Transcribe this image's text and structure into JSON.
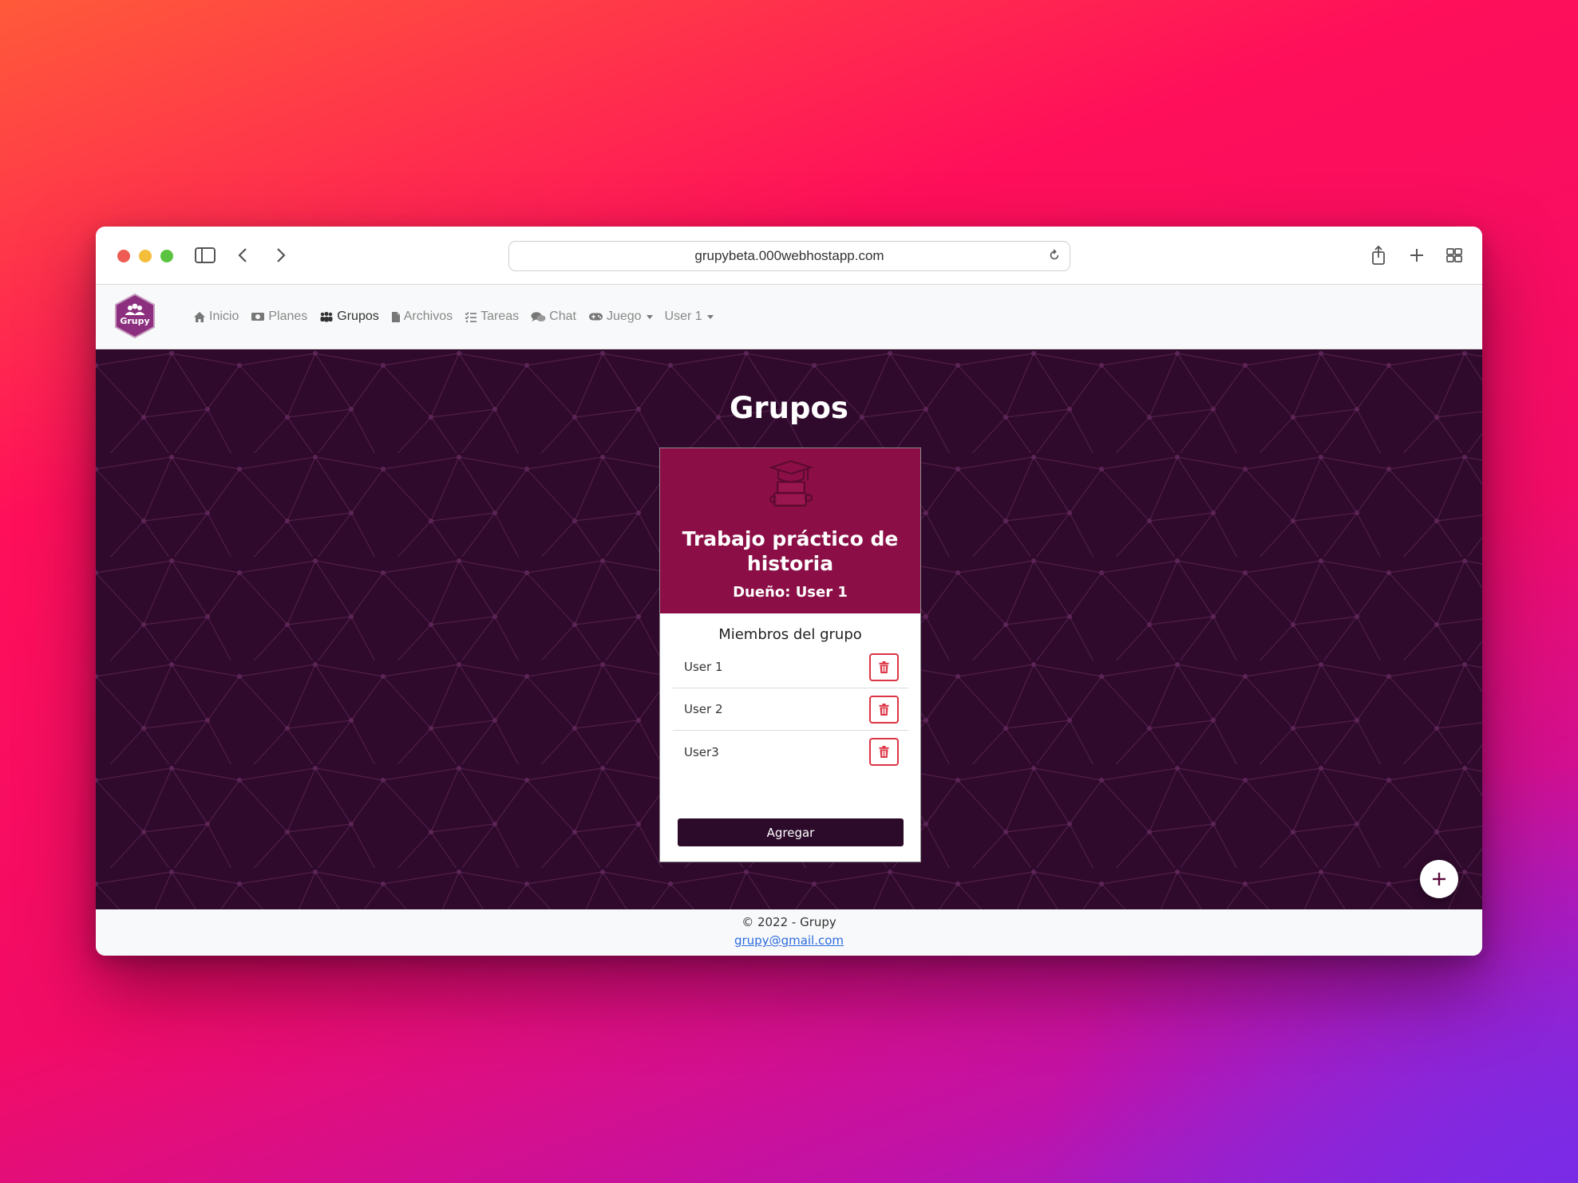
{
  "browser": {
    "url": "grupybeta.000webhostapp.com"
  },
  "navbar": {
    "brand": "Grupy",
    "items": [
      {
        "label": "Inicio",
        "icon": "home-icon"
      },
      {
        "label": "Planes",
        "icon": "money-icon"
      },
      {
        "label": "Grupos",
        "icon": "users-icon",
        "active": true
      },
      {
        "label": "Archivos",
        "icon": "file-icon"
      },
      {
        "label": "Tareas",
        "icon": "tasks-icon"
      },
      {
        "label": "Chat",
        "icon": "chat-icon"
      },
      {
        "label": "Juego",
        "icon": "gamepad-icon",
        "dropdown": true
      },
      {
        "label": "User 1",
        "dropdown": true
      }
    ]
  },
  "page": {
    "title": "Grupos"
  },
  "group_card": {
    "title": "Trabajo práctico de historia",
    "owner": "Dueño: User 1",
    "members_title": "Miembros del grupo",
    "members": [
      "User 1",
      "User 2",
      "User3"
    ],
    "add_label": "Agregar"
  },
  "footer": {
    "copyright": "© 2022 - Grupy",
    "email": "grupy@gmail.com"
  },
  "colors": {
    "brand": "#8b0f46",
    "dark": "#2c0a2a",
    "danger": "#dc3545",
    "link": "#2d6cdf"
  }
}
